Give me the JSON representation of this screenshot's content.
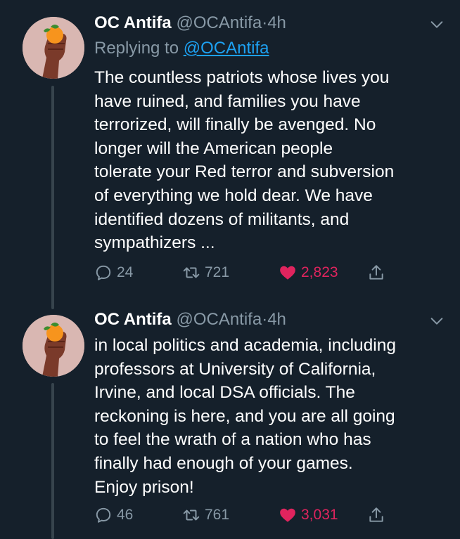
{
  "colors": {
    "background": "#15202b",
    "secondary_text": "#8899a6",
    "link": "#1da1f2",
    "like": "#e0245e"
  },
  "tweets": [
    {
      "name": "OC Antifa",
      "handle": "@OCAntifa",
      "dot": "·",
      "time": "4h",
      "replying_prefix": "Replying to",
      "replying_to": "@OCAntifa",
      "lines": [
        "The countless patriots whose lives you",
        "have ruined, and families you have",
        "terrorized, will finally be avenged. No",
        "longer will the American people",
        "tolerate your Red terror and subversion",
        "of everything we hold dear. We have",
        "identified dozens of militants,  and",
        "sympathizers ..."
      ],
      "replies": "24",
      "retweets": "721",
      "likes": "2,823"
    },
    {
      "name": "OC Antifa",
      "handle": "@OCAntifa",
      "dot": "·",
      "time": "4h",
      "lines": [
        "in local politics and academia, including",
        "professors at University of California,",
        "Irvine, and local DSA officials. The",
        "reckoning is here, and you are all going",
        "to feel the wrath of a nation who has",
        "finally had enough of your games.",
        "Enjoy prison!"
      ],
      "replies": "46",
      "retweets": "761",
      "likes": "3,031"
    }
  ]
}
